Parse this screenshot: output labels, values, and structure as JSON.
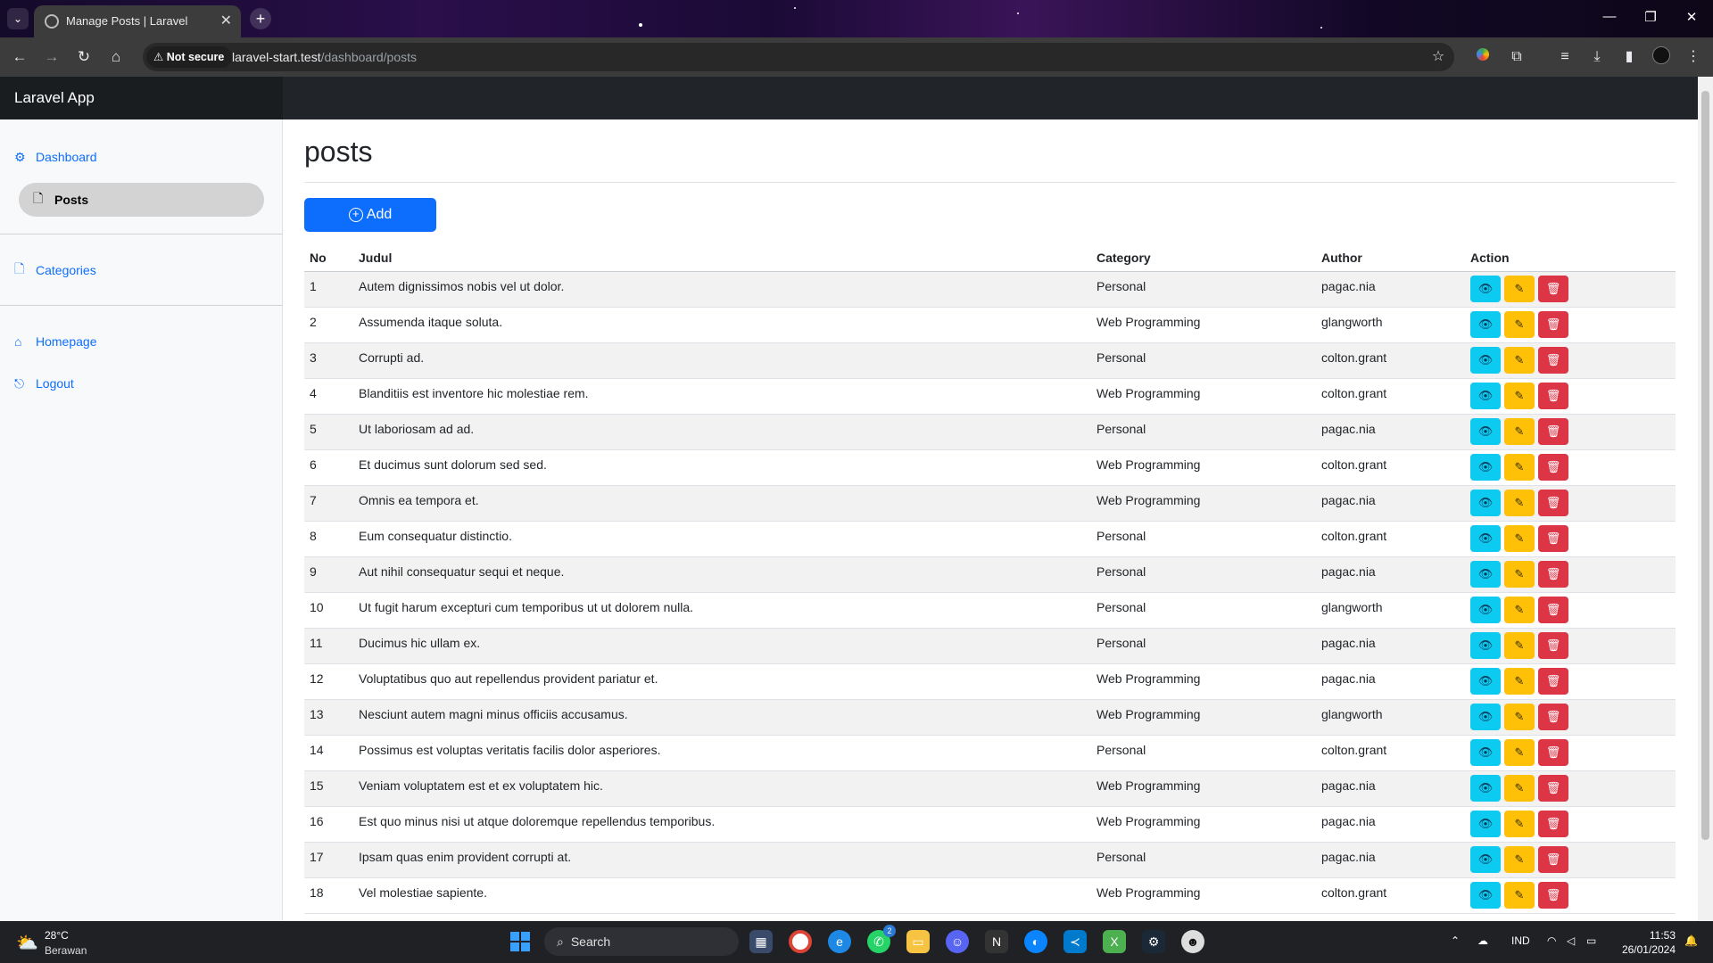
{
  "browser": {
    "tab_title": "Manage Posts | Laravel",
    "security_label": "Not secure",
    "url_host": "laravel-start.test",
    "url_path": "/dashboard/posts"
  },
  "app": {
    "brand": "Laravel App"
  },
  "sidebar": {
    "items": [
      {
        "label": "Dashboard",
        "icon": "gear-icon"
      },
      {
        "label": "Posts",
        "icon": "file-icon",
        "active": true
      },
      {
        "label": "Categories",
        "icon": "file-icon"
      },
      {
        "label": "Homepage",
        "icon": "home-icon"
      },
      {
        "label": "Logout",
        "icon": "logout-icon"
      }
    ]
  },
  "main": {
    "title": "posts",
    "add_label": "Add",
    "columns": [
      "No",
      "Judul",
      "Category",
      "Author",
      "Action"
    ],
    "rows": [
      [
        "1",
        "Autem dignissimos nobis vel ut dolor.",
        "Personal",
        "pagac.nia"
      ],
      [
        "2",
        "Assumenda itaque soluta.",
        "Web Programming",
        "glangworth"
      ],
      [
        "3",
        "Corrupti ad.",
        "Personal",
        "colton.grant"
      ],
      [
        "4",
        "Blanditiis est inventore hic molestiae rem.",
        "Web Programming",
        "colton.grant"
      ],
      [
        "5",
        "Ut laboriosam ad ad.",
        "Personal",
        "pagac.nia"
      ],
      [
        "6",
        "Et ducimus sunt dolorum sed sed.",
        "Web Programming",
        "colton.grant"
      ],
      [
        "7",
        "Omnis ea tempora et.",
        "Web Programming",
        "pagac.nia"
      ],
      [
        "8",
        "Eum consequatur distinctio.",
        "Personal",
        "colton.grant"
      ],
      [
        "9",
        "Aut nihil consequatur sequi et neque.",
        "Personal",
        "pagac.nia"
      ],
      [
        "10",
        "Ut fugit harum excepturi cum temporibus ut ut dolorem nulla.",
        "Personal",
        "glangworth"
      ],
      [
        "11",
        "Ducimus hic ullam ex.",
        "Personal",
        "pagac.nia"
      ],
      [
        "12",
        "Voluptatibus quo aut repellendus provident pariatur et.",
        "Web Programming",
        "pagac.nia"
      ],
      [
        "13",
        "Nesciunt autem magni minus officiis accusamus.",
        "Web Programming",
        "glangworth"
      ],
      [
        "14",
        "Possimus est voluptas veritatis facilis dolor asperiores.",
        "Personal",
        "colton.grant"
      ],
      [
        "15",
        "Veniam voluptatem est et ex voluptatem hic.",
        "Web Programming",
        "pagac.nia"
      ],
      [
        "16",
        "Est quo minus nisi ut atque doloremque repellendus temporibus.",
        "Web Programming",
        "pagac.nia"
      ],
      [
        "17",
        "Ipsam quas enim provident corrupti at.",
        "Personal",
        "pagac.nia"
      ],
      [
        "18",
        "Vel molestiae sapiente.",
        "Web Programming",
        "colton.grant"
      ]
    ]
  },
  "colors": {
    "primary": "#0d6efd",
    "view": "#0dcaf0",
    "edit": "#ffc107",
    "delete": "#dc3545"
  },
  "taskbar": {
    "temperature": "28°C",
    "weather": "Berawan",
    "search_placeholder": "Search",
    "language": "IND",
    "time": "11:53",
    "date": "26/01/2024",
    "whatsapp_badge": "2"
  }
}
